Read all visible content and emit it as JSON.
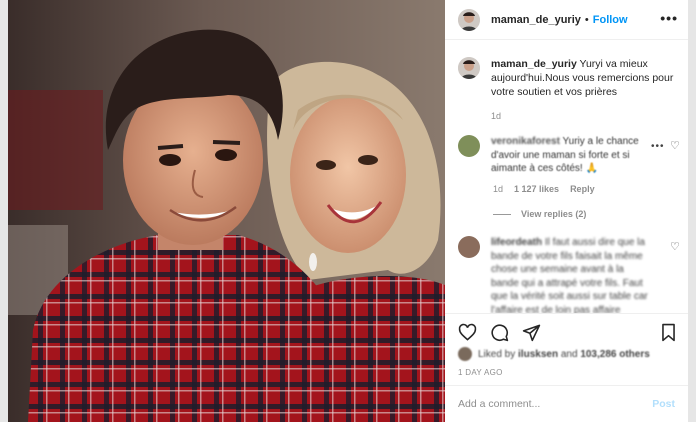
{
  "header": {
    "username": "maman_de_yuriy",
    "separator": "•",
    "follow_label": "Follow",
    "more_label": "•••"
  },
  "caption": {
    "username": "maman_de_yuriy",
    "text": "Yuryi va mieux aujourd'hui.Nous vous remercions pour votre soutien et vos prières",
    "age": "1d"
  },
  "comments": [
    {
      "username": "veronikaforest",
      "text": "Yuriy a le chance d'avoir une maman si forte et si aimante à ces côtés! 🙏",
      "age": "1d",
      "likes": "1 127 likes",
      "reply_label": "Reply",
      "view_replies": "View replies (2)",
      "options": "•••"
    },
    {
      "username": "lifeordeath",
      "text": "Il faut aussi dire que la bande de votre fils faisait la même chose une semaine avant à la bande qui a attrapé votre fils. Faut que la vérité soit aussi sur table car l'affaire est de loin pas affaire nombril de"
    }
  ],
  "actions": {
    "liked_by": "Liked by",
    "liked_user": "ilusksen",
    "liked_and": "and",
    "liked_others": "103,286 others",
    "posted_ago": "1 DAY AGO"
  },
  "add_comment": {
    "placeholder": "Add a comment...",
    "post_label": "Post"
  },
  "icons": [
    "heart-icon",
    "comment-icon",
    "share-icon",
    "bookmark-icon"
  ],
  "colors": {
    "accent": "#0095f6",
    "post_disabled": "#b2dffc"
  }
}
